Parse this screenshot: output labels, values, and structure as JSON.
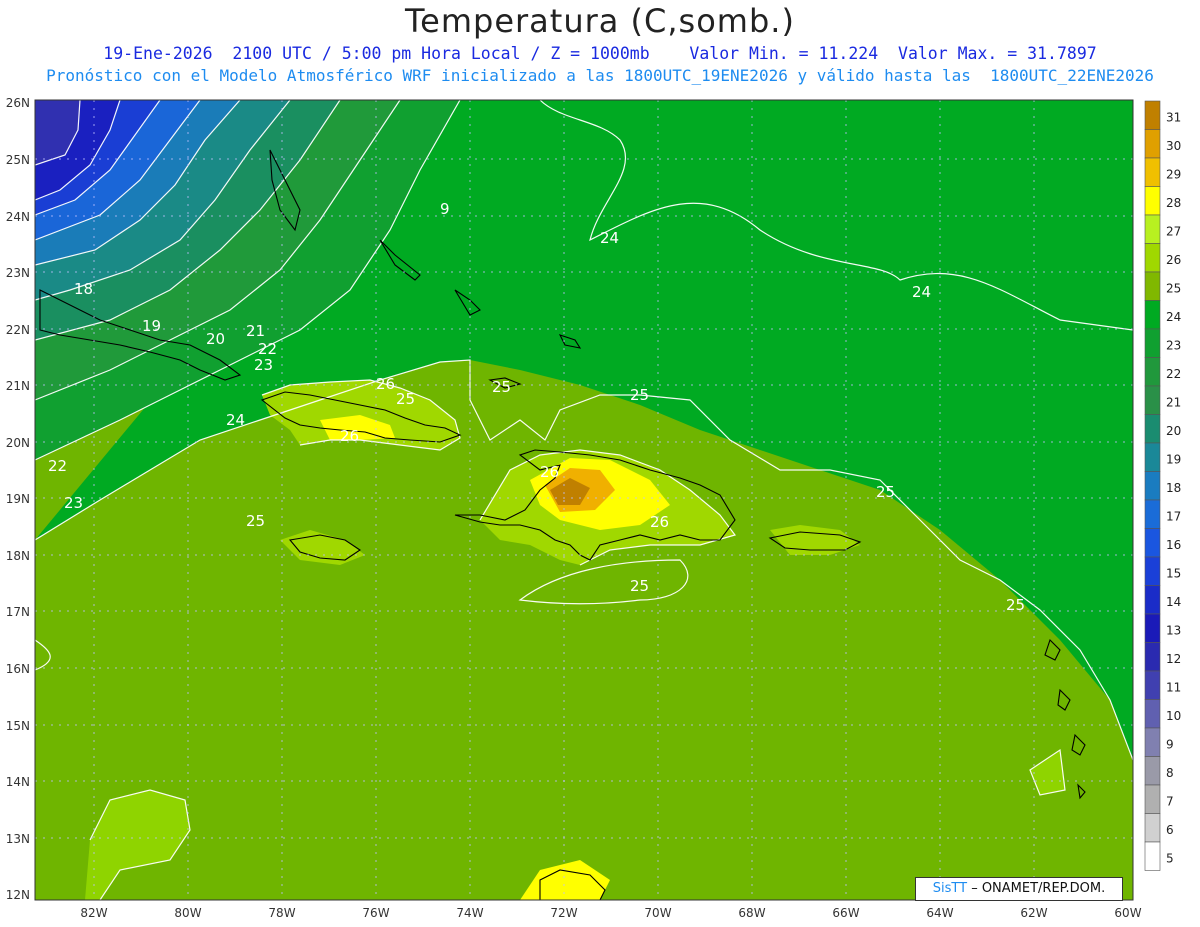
{
  "header": {
    "title": "Temperatura (C,somb.)",
    "line1": "19-Ene-2026  2100 UTC / 5:00 pm Hora Local / Z = 1000mb    Valor Min. = 11.224  Valor Max. = 31.7897",
    "line2": "Pronóstico con el Modelo Atmosférico WRF inicializado a las 1800UTC_19ENE2026 y válido hasta las  1800UTC_22ENE2026"
  },
  "map": {
    "lat_labels": [
      "26N",
      "25N",
      "24N",
      "23N",
      "22N",
      "21N",
      "20N",
      "19N",
      "18N",
      "17N",
      "16N",
      "15N",
      "14N",
      "13N",
      "12N"
    ],
    "lon_labels": [
      "82W",
      "80W",
      "78W",
      "76W",
      "74W",
      "72W",
      "70W",
      "68W",
      "66W",
      "64W",
      "62W",
      "60W"
    ],
    "contour_labels": [
      {
        "text": "24"
      },
      {
        "text": "24"
      },
      {
        "text": "18"
      },
      {
        "text": "19"
      },
      {
        "text": "20"
      },
      {
        "text": "21"
      },
      {
        "text": "22"
      },
      {
        "text": "23"
      },
      {
        "text": "24"
      },
      {
        "text": "22"
      },
      {
        "text": "23"
      },
      {
        "text": "26"
      },
      {
        "text": "25"
      },
      {
        "text": "26"
      },
      {
        "text": "25"
      },
      {
        "text": "25"
      },
      {
        "text": "26"
      },
      {
        "text": "26"
      },
      {
        "text": "25"
      },
      {
        "text": "25"
      },
      {
        "text": "25"
      },
      {
        "text": "25"
      },
      {
        "text": "9"
      }
    ]
  },
  "colorbar": {
    "labels": [
      "31",
      "30",
      "29",
      "28",
      "27",
      "26",
      "25",
      "24",
      "23",
      "22",
      "21",
      "20",
      "19",
      "18",
      "17",
      "16",
      "15",
      "14",
      "13",
      "12",
      "11",
      "10",
      "9",
      "8",
      "7",
      "6",
      "5"
    ],
    "colors": [
      "#c08000",
      "#e0a000",
      "#f0c000",
      "#ffff00",
      "#b8f020",
      "#a0d800",
      "#80b800",
      "#00aa22",
      "#10a030",
      "#20983c",
      "#2a9048",
      "#1a8c70",
      "#1a8898",
      "#1a7cc0",
      "#1a6cd8",
      "#1a56e0",
      "#1a40d8",
      "#1a2cc8",
      "#1a1ab8",
      "#2a2ab0",
      "#4040b0",
      "#6060b0",
      "#8080b0",
      "#9a9aa8",
      "#b0b0b0",
      "#d0d0d0",
      "#ffffff"
    ]
  },
  "credit": {
    "sis": "SisTT",
    "rest": " – ONAMET/REP.DOM."
  }
}
